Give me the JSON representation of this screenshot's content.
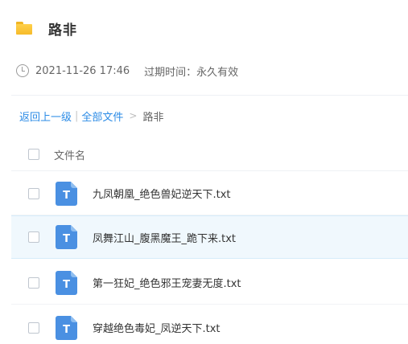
{
  "header": {
    "folder_icon": "folder-icon",
    "title": "路非"
  },
  "meta": {
    "clock_icon": "clock-icon",
    "datetime": "2021-11-26 17:46",
    "expire_label": "过期时间：永久有效"
  },
  "breadcrumb": {
    "back": "返回上一级",
    "separator": "|",
    "all_files": "全部文件",
    "arrow": ">",
    "current": "路非"
  },
  "list": {
    "column_name": "文件名",
    "files": [
      {
        "name": "九凤朝凰_绝色兽妃逆天下.txt",
        "icon": "txt-file-icon",
        "icon_letter": "T"
      },
      {
        "name": "凤舞江山_腹黑魔王_跪下来.txt",
        "icon": "txt-file-icon",
        "icon_letter": "T"
      },
      {
        "name": "第一狂妃_绝色邪王宠妻无度.txt",
        "icon": "txt-file-icon",
        "icon_letter": "T"
      },
      {
        "name": "穿越绝色毒妃_凤逆天下.txt",
        "icon": "txt-file-icon",
        "icon_letter": "T"
      }
    ]
  },
  "colors": {
    "link": "#2b8be6",
    "file_icon": "#4a90e2",
    "folder": "#f6bb2a",
    "row_hover": "#f0f8fd"
  }
}
